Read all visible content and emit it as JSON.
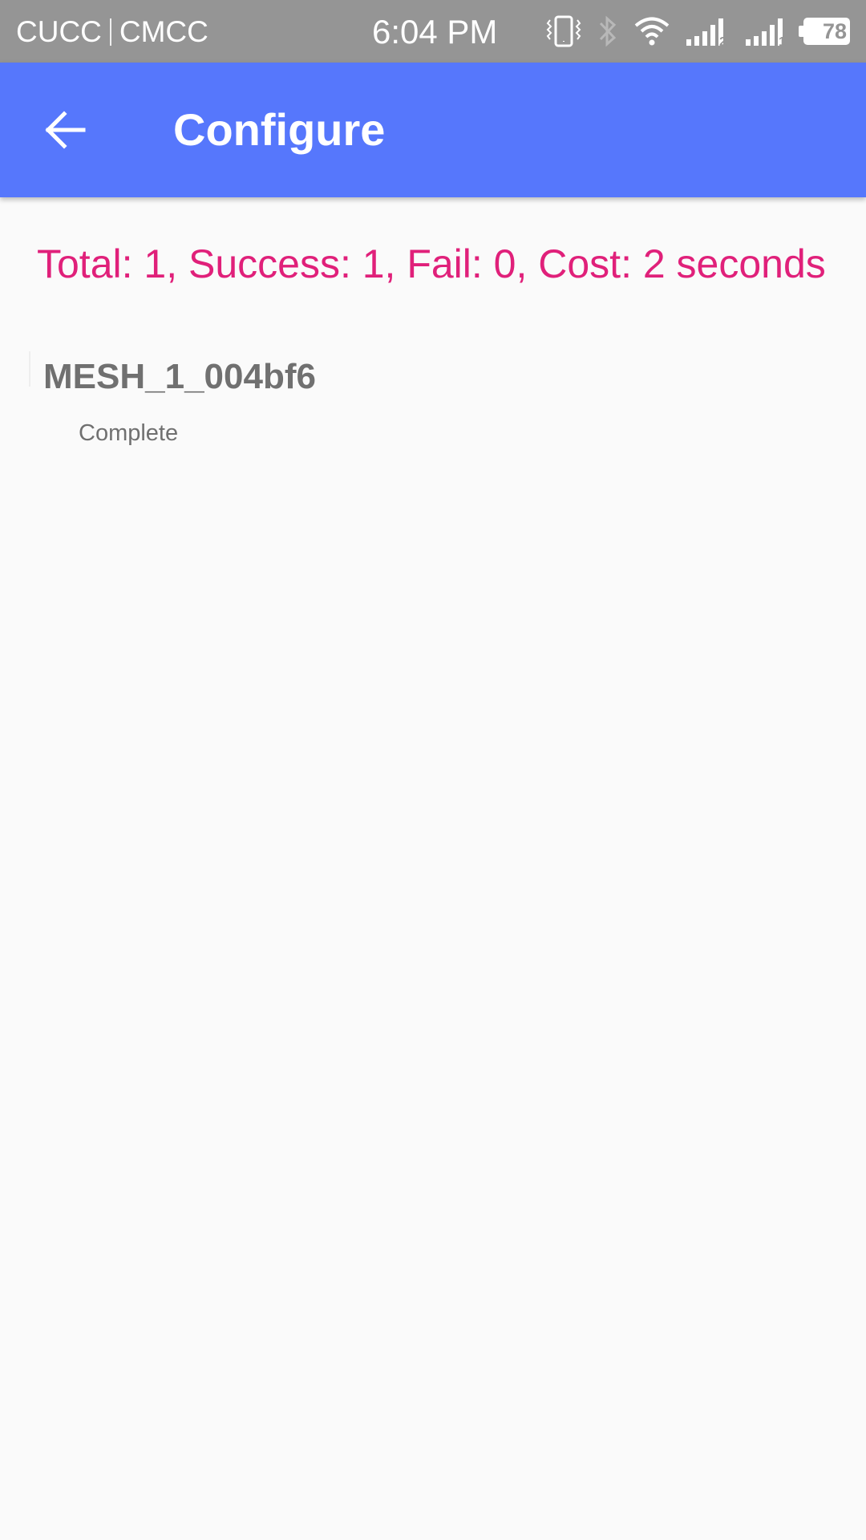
{
  "status_bar": {
    "carrier_1": "CUCC",
    "carrier_2": "CMCC",
    "time": "6:04 PM",
    "battery_level": "78",
    "icons": [
      "vibrate-icon",
      "bluetooth-icon",
      "wifi-icon",
      "signal-sim2-icon",
      "signal-sim1-icon",
      "battery-icon"
    ],
    "sim2_label": "2",
    "sim1_label": "1"
  },
  "app_bar": {
    "title": "Configure",
    "back_icon": "arrow-back-icon",
    "background_color": "#5677fc"
  },
  "summary": {
    "text": "Total: 1, Success: 1, Fail: 0, Cost: 2 seconds",
    "color": "#e0207a"
  },
  "devices": [
    {
      "name": "MESH_1_004bf6",
      "status": "Complete"
    }
  ]
}
